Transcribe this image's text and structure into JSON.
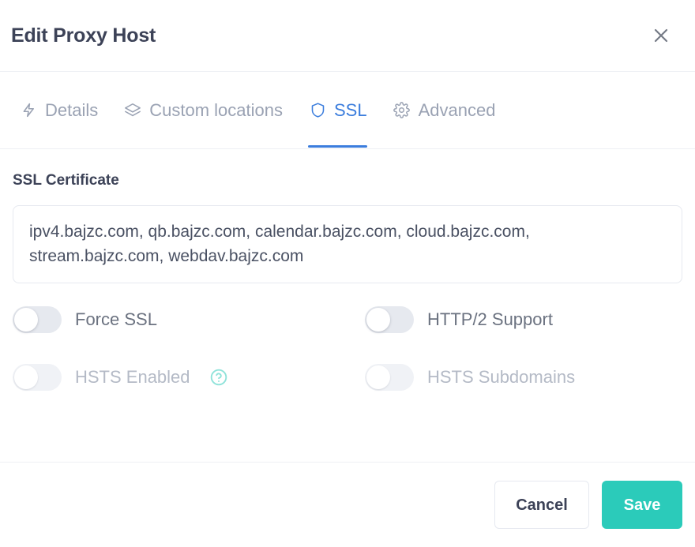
{
  "header": {
    "title": "Edit Proxy Host",
    "close_icon": "close-icon"
  },
  "tabs": [
    {
      "label": "Details",
      "icon": "zap-icon",
      "active": false
    },
    {
      "label": "Custom locations",
      "icon": "layers-icon",
      "active": false
    },
    {
      "label": "SSL",
      "icon": "shield-icon",
      "active": true
    },
    {
      "label": "Advanced",
      "icon": "gear-icon",
      "active": false
    }
  ],
  "ssl": {
    "certificate_label": "SSL Certificate",
    "certificate_value": "ipv4.bajzc.com, qb.bajzc.com, calendar.bajzc.com, cloud.bajzc.com, stream.bajzc.com, webdav.bajzc.com",
    "toggles": [
      {
        "label": "Force SSL",
        "state": "off",
        "disabled": false,
        "help": false
      },
      {
        "label": "HTTP/2 Support",
        "state": "off",
        "disabled": false,
        "help": false
      },
      {
        "label": "HSTS Enabled",
        "state": "off",
        "disabled": true,
        "help": true,
        "help_icon": "help-circle-icon"
      },
      {
        "label": "HSTS Subdomains",
        "state": "off",
        "disabled": true,
        "help": false
      }
    ]
  },
  "footer": {
    "cancel_label": "Cancel",
    "save_label": "Save"
  },
  "colors": {
    "accent_tab": "#3b7ddd",
    "save_button": "#2bcbba",
    "help_icon": "#8fe3da",
    "title_text": "#3c4257",
    "muted_text": "#b4bac6"
  }
}
